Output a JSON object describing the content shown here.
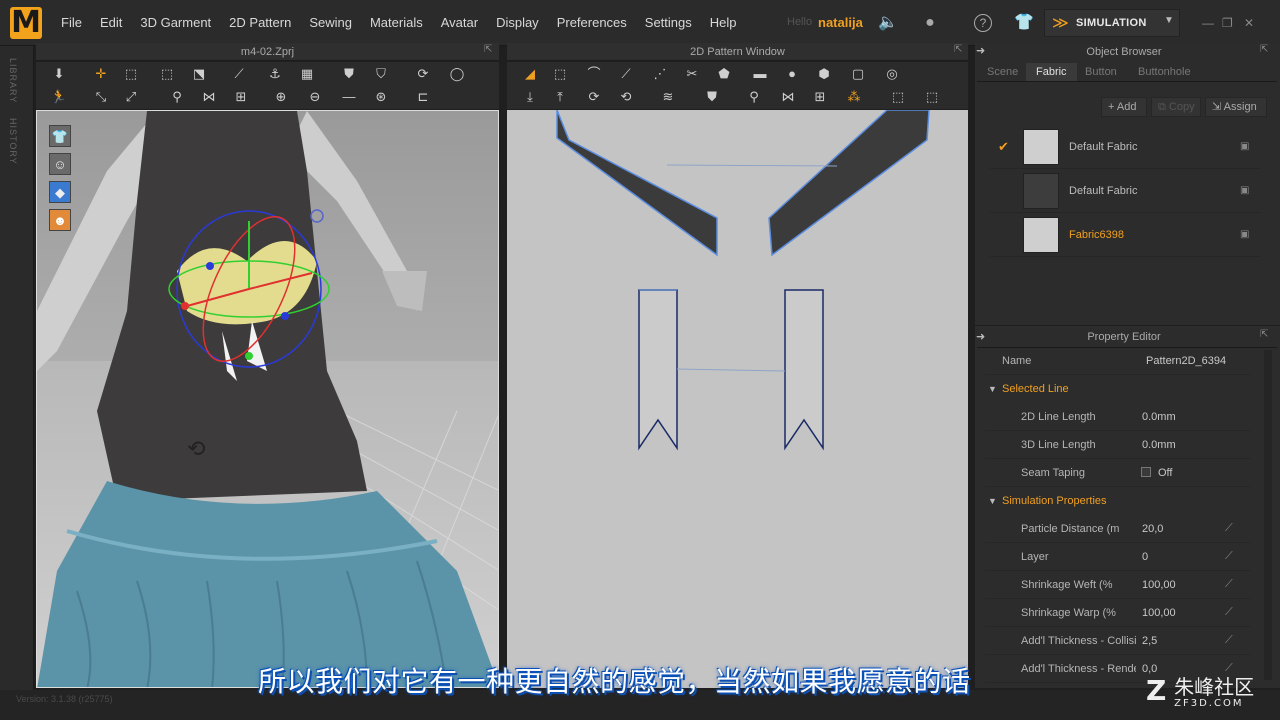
{
  "app": {
    "logo": "M",
    "menu": [
      "File",
      "Edit",
      "3D Garment",
      "2D Pattern",
      "Sewing",
      "Materials",
      "Avatar",
      "Display",
      "Preferences",
      "Settings",
      "Help"
    ],
    "user_hello": "Hello",
    "user_name": "natalija",
    "simulation_label": "SIMULATION"
  },
  "side_tabs": [
    "LIBRARY",
    "HISTORY"
  ],
  "view3d": {
    "title": "m4-02.Zprj"
  },
  "view2d": {
    "title": "2D Pattern Window"
  },
  "object_browser": {
    "title": "Object Browser",
    "tabs": [
      "Scene",
      "Fabric",
      "Button",
      "Buttonhole"
    ],
    "active_tab": "Fabric",
    "actions": [
      "Add",
      "Copy",
      "Assign"
    ],
    "fabrics": [
      {
        "name": "Default Fabric",
        "swatch": "#cfcfcf",
        "checked": true,
        "highlight": false
      },
      {
        "name": "Default Fabric",
        "swatch": "#3d3d3d",
        "checked": false,
        "highlight": false
      },
      {
        "name": "Fabric6398",
        "swatch": "#cfcfcf",
        "checked": false,
        "highlight": true
      }
    ]
  },
  "property_editor": {
    "title": "Property Editor",
    "name_label": "Name",
    "name_value": "Pattern2D_6394",
    "sections": [
      {
        "title": "Selected Line",
        "rows": [
          {
            "label": "2D Line Length",
            "value": "0.0mm",
            "editable": false
          },
          {
            "label": "3D Line Length",
            "value": "0.0mm",
            "editable": false
          },
          {
            "label": "Seam Taping",
            "value": "Off",
            "checkbox": true,
            "editable": false
          }
        ]
      },
      {
        "title": "Simulation Properties",
        "rows": [
          {
            "label": "Particle Distance (m",
            "value": "20,0",
            "editable": true
          },
          {
            "label": "Layer",
            "value": "0",
            "editable": true
          },
          {
            "label": "Shrinkage Weft (%",
            "value": "100,00",
            "editable": true
          },
          {
            "label": "Shrinkage Warp (%",
            "value": "100,00",
            "editable": true
          },
          {
            "label": "Add'l Thickness - Collisic",
            "value": "2,5",
            "editable": true
          },
          {
            "label": "Add'l Thickness - Render",
            "value": "0,0",
            "editable": true
          }
        ]
      }
    ]
  },
  "status": {
    "version": "Version: 3.1.38 (r25775)"
  },
  "subtitle": "所以我们对它有一种更自然的感觉，当然如果我愿意的话",
  "watermark": {
    "main": "朱峰社区",
    "sub": "ZF3D.COM"
  }
}
